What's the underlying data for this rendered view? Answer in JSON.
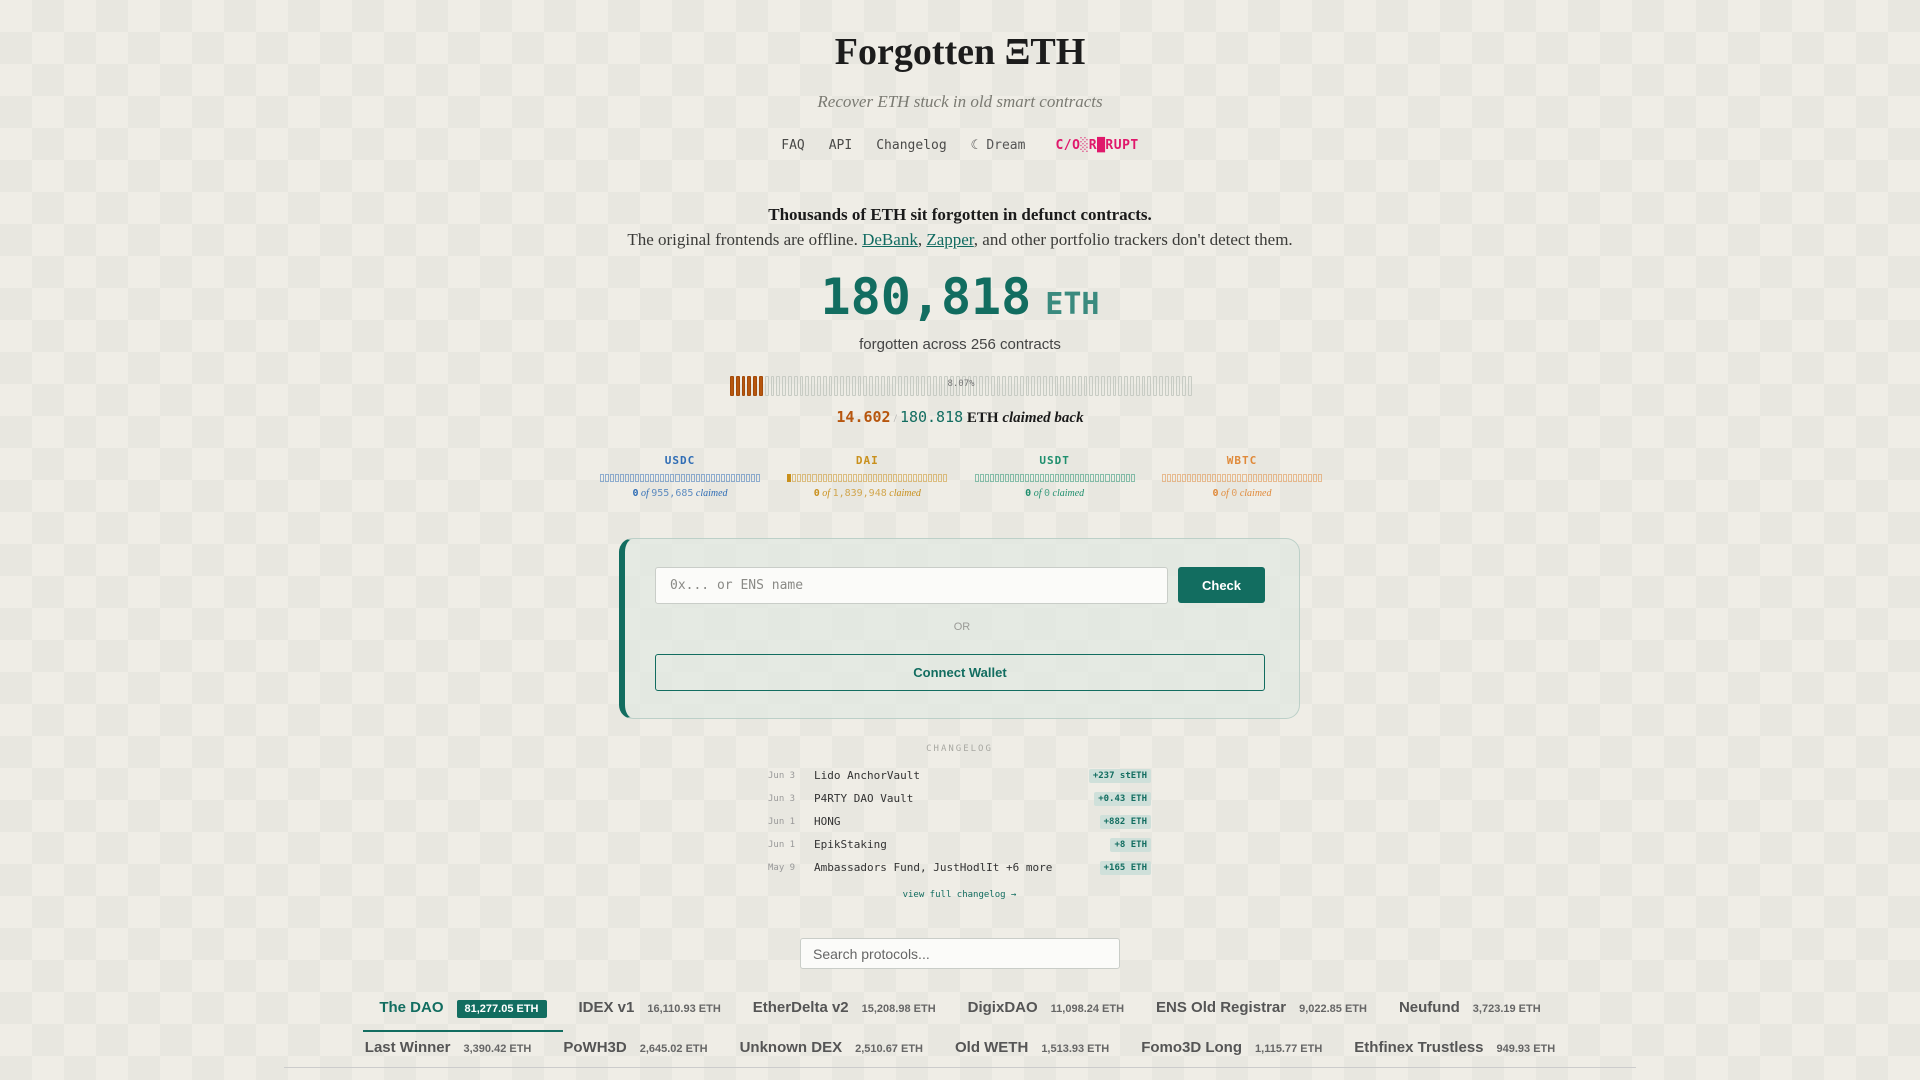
{
  "header": {
    "title": "Forgotten ΞTH",
    "subtitle": "Recover ETH stuck in old smart contracts",
    "nav": {
      "faq": "FAQ",
      "api": "API",
      "changelog": "Changelog",
      "dream": "☾ Dream",
      "corrupt": "C/O░R█RUPT"
    }
  },
  "intro": {
    "headline": "Thousands of ETH sit forgotten in defunct contracts.",
    "line_prefix": "The original frontends are offline.",
    "link1": "DeBank",
    "comma": ",",
    "link2": "Zapper",
    "line_suffix": ", and other portfolio trackers don't detect them."
  },
  "total": {
    "value": "180,818",
    "unit": "ETH",
    "caption": "forgotten across 256 contracts"
  },
  "progress": {
    "percent_label": "8.07%",
    "fraction": 0.0807,
    "claimed": "14.602",
    "slash": "/",
    "total": "180.818",
    "eth": "ETH",
    "claimed_back": "claimed back"
  },
  "tokens": [
    {
      "name": "USDC",
      "claimed": "0",
      "of": "of",
      "total": "955,685",
      "suffix": "claimed",
      "color": "#2f6db5",
      "fraction": 0.0
    },
    {
      "name": "DAI",
      "claimed": "0",
      "of": "of",
      "total": "1,839,948",
      "suffix": "claimed",
      "color": "#c9901c",
      "fraction": 0.01
    },
    {
      "name": "USDT",
      "claimed": "0",
      "of": "of",
      "total": "0",
      "suffix": "claimed",
      "color": "#1f8f6e",
      "fraction": 0.0
    },
    {
      "name": "WBTC",
      "claimed": "0",
      "of": "of",
      "total": "0",
      "suffix": "claimed",
      "color": "#e08a3a",
      "fraction": 0.0
    }
  ],
  "lookup": {
    "placeholder": "0x... or ENS name",
    "check": "Check",
    "or": "OR",
    "connect": "Connect Wallet"
  },
  "changelog": {
    "heading": "CHANGELOG",
    "entries": [
      {
        "date": "Jun 3",
        "name": "Lido AnchorVault",
        "badge": "+237 stETH"
      },
      {
        "date": "Jun 3",
        "name": "P4RTY DAO Vault",
        "badge": "+0.43 ETH"
      },
      {
        "date": "Jun 1",
        "name": "HONG",
        "badge": "+882 ETH"
      },
      {
        "date": "Jun 1",
        "name": "EpikStaking",
        "badge": "+8 ETH"
      },
      {
        "date": "May 9",
        "name": "Ambassadors Fund, JustHodlIt +6 more",
        "badge": "+165 ETH"
      }
    ],
    "more": "view full changelog →"
  },
  "search": {
    "placeholder": "Search protocols..."
  },
  "protocols": {
    "row1": [
      {
        "name": "The DAO",
        "value": "81,277.05 ETH"
      },
      {
        "name": "IDEX v1",
        "value": "16,110.93 ETH"
      },
      {
        "name": "EtherDelta v2",
        "value": "15,208.98 ETH"
      },
      {
        "name": "DigixDAO",
        "value": "11,098.24 ETH"
      },
      {
        "name": "ENS Old Registrar",
        "value": "9,022.85 ETH"
      },
      {
        "name": "Neufund",
        "value": "3,723.19 ETH"
      }
    ],
    "row2": [
      {
        "name": "Last Winner",
        "value": "3,390.42 ETH"
      },
      {
        "name": "PoWH3D",
        "value": "2,645.02 ETH"
      },
      {
        "name": "Unknown DEX",
        "value": "2,510.67 ETH"
      },
      {
        "name": "Old WETH",
        "value": "1,513.93 ETH"
      },
      {
        "name": "Fomo3D Long",
        "value": "1,115.77 ETH"
      },
      {
        "name": "Ethfinex Trustless",
        "value": "949.93 ETH"
      }
    ]
  },
  "colors": {
    "accent": "#126d60",
    "claimed": "#b7560e",
    "corrupt": "#e0186b"
  }
}
